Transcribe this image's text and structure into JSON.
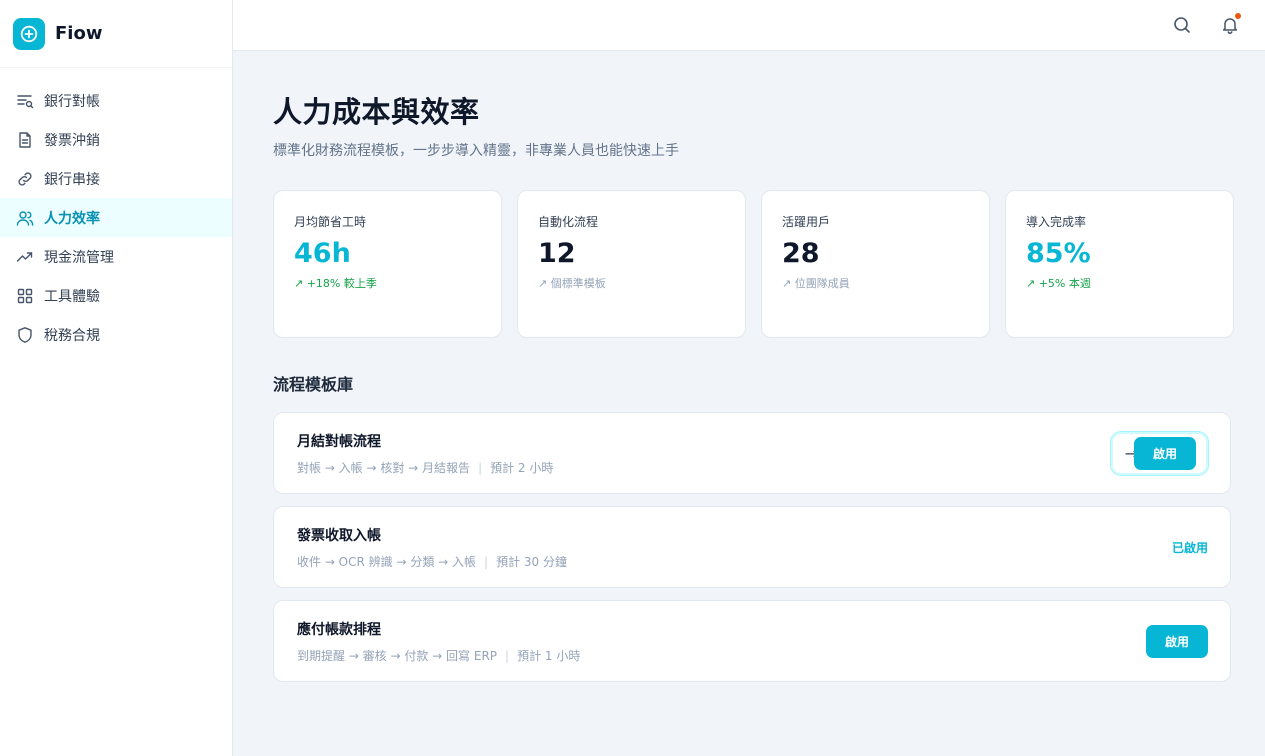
{
  "brand": {
    "name": "Fiow"
  },
  "sidebar": {
    "items": [
      {
        "label": "銀行對帳",
        "icon": "filter-search-icon"
      },
      {
        "label": "發票沖銷",
        "icon": "document-icon"
      },
      {
        "label": "銀行串接",
        "icon": "link-icon"
      },
      {
        "label": "人力效率",
        "icon": "users-icon"
      },
      {
        "label": "現金流管理",
        "icon": "trending-up-icon"
      },
      {
        "label": "工具體驗",
        "icon": "grid-icon"
      },
      {
        "label": "稅務合規",
        "icon": "shield-icon"
      }
    ],
    "active_index": 3
  },
  "topbar": {
    "search_icon": "search-icon",
    "bell_icon": "bell-icon"
  },
  "page": {
    "title": "人力成本與效率",
    "subtitle": "標準化財務流程模板，一步步導入精靈，非專業人員也能快速上手"
  },
  "stats": [
    {
      "label": "月均節省工時",
      "value": "46h",
      "note": "↗ +18% 較上季"
    },
    {
      "label": "自動化流程",
      "value": "12",
      "note": "↗ 個標準模板"
    },
    {
      "label": "活躍用戶",
      "value": "28",
      "note": "↗ 位團隊成員"
    },
    {
      "label": "導入完成率",
      "value": "85%",
      "note": "↗ +5% 本週"
    }
  ],
  "templates_section": {
    "title": "流程模板庫"
  },
  "templates": [
    {
      "name": "月結對帳流程",
      "steps": "對帳 → 入帳 → 核對 → 月結報告",
      "estimate": "預計 2 小時",
      "action": "啟用"
    },
    {
      "name": "發票收取入帳",
      "steps": "收件 → OCR 辨識 → 分類 → 入帳",
      "estimate": "預計 30 分鐘",
      "status": "已啟用"
    },
    {
      "name": "應付帳款排程",
      "steps": "到期提醒 → 審核 → 付款 → 回寫 ERP",
      "estimate": "預計 1 小時",
      "action": "啟用"
    }
  ],
  "colors": {
    "accent": "#06b6d4",
    "positive": "#16a34a",
    "notification": "#ea580c"
  }
}
